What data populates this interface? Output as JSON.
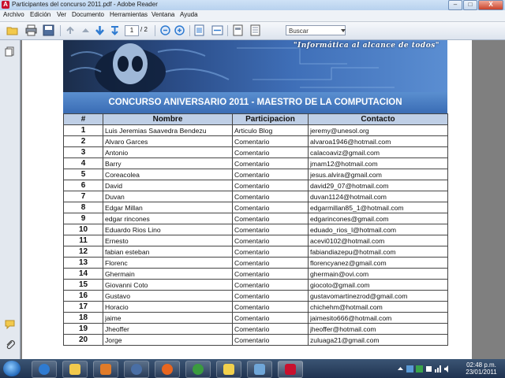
{
  "window": {
    "title": "Participantes del concurso 2011.pdf - Adobe Reader",
    "minimize": "–",
    "maximize": "□",
    "close": "X"
  },
  "menu": [
    "Archivo",
    "Edición",
    "Ver",
    "Documento",
    "Herramientas",
    "Ventana",
    "Ayuda"
  ],
  "toolbar": {
    "page_current": "1",
    "page_total": "/ 2",
    "search_placeholder": "Buscar"
  },
  "document": {
    "banner_slogan": "\"Informática al alcance de todos\"",
    "table_title": "CONCURSO ANIVERSARIO 2011 - MAESTRO DE LA COMPUTACION",
    "headers": [
      "#",
      "Nombre",
      "Participacion",
      "Contacto"
    ],
    "rows": [
      [
        "1",
        "Luis Jeremias Saavedra Bendezu",
        "Articulo Blog",
        "jeremy@unesol.org"
      ],
      [
        "2",
        "Alvaro Garces",
        "Comentario",
        "alvaroa1946@hotmail.com"
      ],
      [
        "3",
        "Antonio",
        "Comentario",
        "calacoaviz@gmail.com"
      ],
      [
        "4",
        "Barry",
        "Comentario",
        "jmam12@hotmail.com"
      ],
      [
        "5",
        "Coreacolea",
        "Comentario",
        "jesus.alvira@gmail.com"
      ],
      [
        "6",
        "David",
        "Comentario",
        "david29_07@hotmail.com"
      ],
      [
        "7",
        "Duvan",
        "Comentario",
        "duvan1124@hotmail.com"
      ],
      [
        "8",
        "Edgar Millan",
        "Comentario",
        "edgarmillan85_1@hotmail.com"
      ],
      [
        "9",
        "edgar rincones",
        "Comentario",
        "edgarincones@gmail.com"
      ],
      [
        "10",
        "Eduardo Rios Lino",
        "Comentario",
        "eduado_rios_l@hotmail.com"
      ],
      [
        "11",
        "Ernesto",
        "Comentario",
        "acevi0102@hotmail.com"
      ],
      [
        "12",
        "fabian esteban",
        "Comentario",
        "fabiandiazepu@hotmail.com"
      ],
      [
        "13",
        "Florenc",
        "Comentario",
        "florencyanez@gmail.com"
      ],
      [
        "14",
        "Ghermain",
        "Comentario",
        "ghermain@ovi.com"
      ],
      [
        "15",
        "Giovanni Coto",
        "Comentario",
        "giocoto@gmail.com"
      ],
      [
        "16",
        "Gustavo",
        "Comentario",
        "gustavomartinezrod@gmail.com"
      ],
      [
        "17",
        "Horacio",
        "Comentario",
        "chichehm@hotmail.com"
      ],
      [
        "18",
        "jaime",
        "Comentario",
        "jaimesito666@hotmail.com"
      ],
      [
        "19",
        "Jheoffer",
        "Comentario",
        "jheoffer@hotmail.com"
      ],
      [
        "20",
        "Jorge",
        "Comentario",
        "zuluaga21@gmail.com"
      ]
    ]
  },
  "taskbar": {
    "time": "02:48 p.m.",
    "date": "23/01/2011"
  },
  "colors": {
    "table_title_bg": "#3a6cb4",
    "header_bg": "#bfcfe6",
    "app_accent": "#c8102e"
  }
}
